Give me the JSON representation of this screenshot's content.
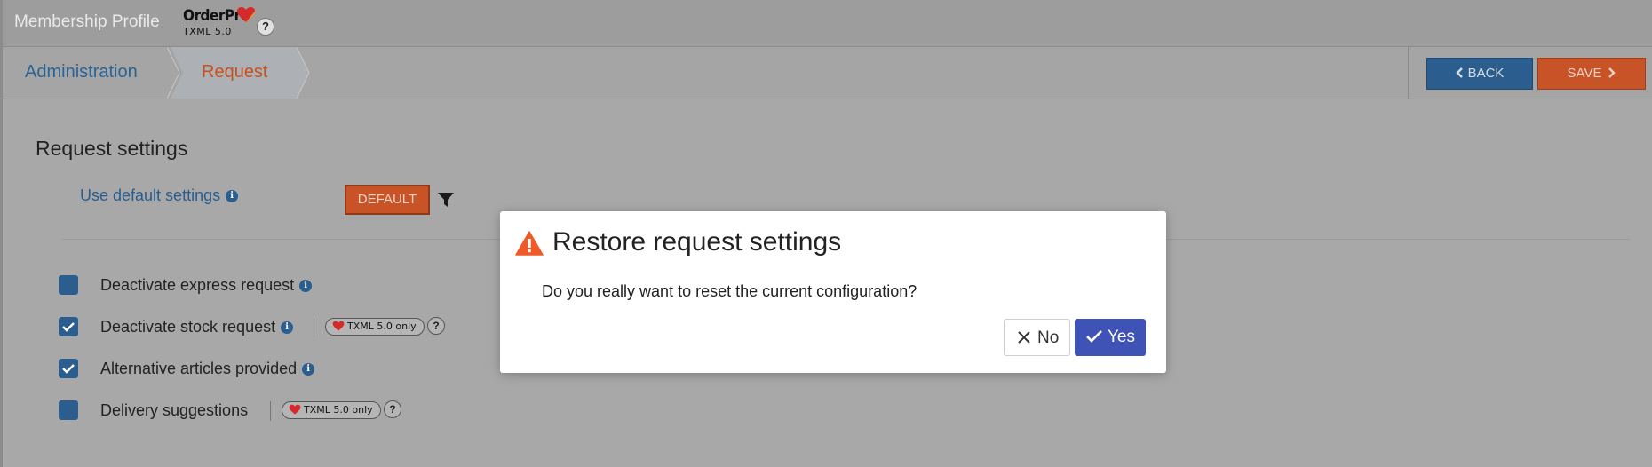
{
  "header": {
    "app_title": "Membership Profile",
    "logo_brand": "OrderPro",
    "logo_sub": "TXML 5.0",
    "help_label": "?"
  },
  "breadcrumb": {
    "items": [
      "Administration",
      "Request"
    ]
  },
  "toolbar": {
    "back_label": "BACK",
    "save_label": "SAVE"
  },
  "settings": {
    "title": "Request settings",
    "use_default_label": "Use default settings",
    "default_button": "DEFAULT",
    "info_glyph": "i",
    "options": [
      {
        "label": "Deactivate express request",
        "checked": false,
        "info": true
      },
      {
        "label": "Deactivate stock request",
        "checked": true,
        "info": true,
        "badge": "TXML 5.0 only",
        "help": "?"
      },
      {
        "label": "Alternative articles provided",
        "checked": true,
        "info": true
      },
      {
        "label": "Delivery suggestions",
        "checked": false,
        "info": false,
        "badge": "TXML 5.0 only",
        "help": "?"
      }
    ]
  },
  "dialog": {
    "title": "Restore request settings",
    "message": "Do you really want to reset the current configuration?",
    "no_label": "No",
    "yes_label": "Yes"
  },
  "colors": {
    "primary": "#2b5e8f",
    "accent": "#c85326",
    "confirm": "#3f52b5",
    "warning": "#f05a28"
  }
}
